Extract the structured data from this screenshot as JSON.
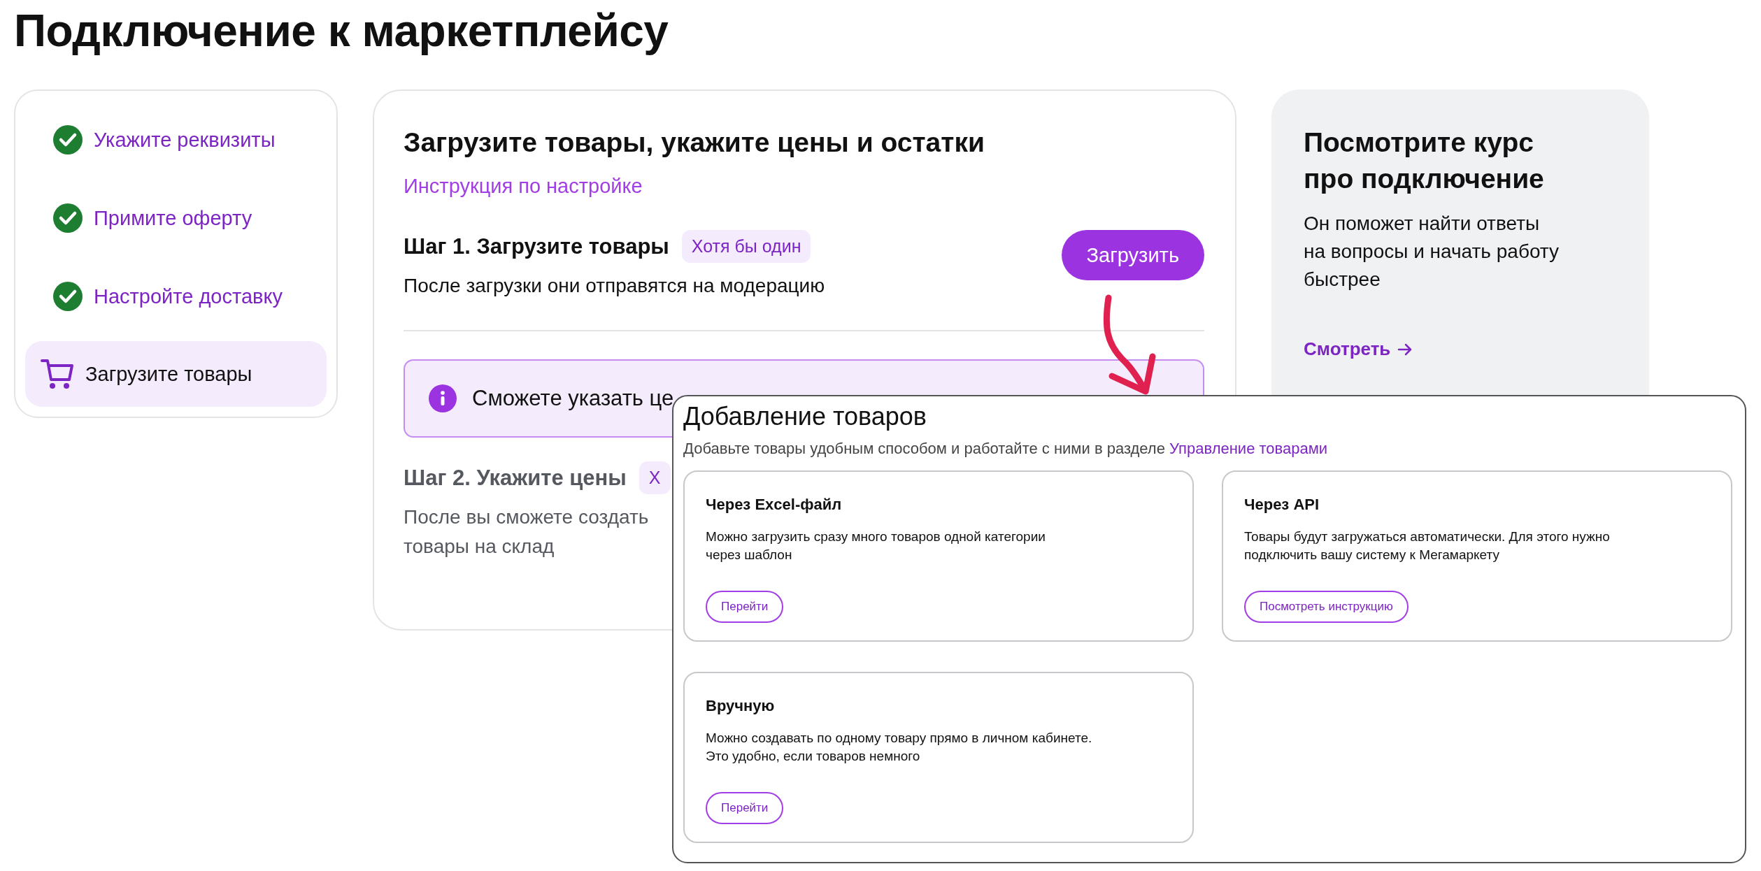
{
  "page": {
    "title": "Подключение к маркетплейсу"
  },
  "steps": [
    {
      "label": "Укажите реквизиты",
      "done": true,
      "selected": false
    },
    {
      "label": "Примите оферту",
      "done": true,
      "selected": false
    },
    {
      "label": "Настройте доставку",
      "done": true,
      "selected": false
    },
    {
      "label": "Загрузите товары",
      "done": false,
      "selected": true
    }
  ],
  "main": {
    "title": "Загрузите товары, укажите цены и остатки",
    "link": "Инструкция по настройке",
    "stages": [
      {
        "title": "Шаг 1. Загрузите товары",
        "badge": "Хотя бы один",
        "lines": [
          "После загрузки они отправятся на модерацию"
        ],
        "button": "Загрузить",
        "disabled": false
      },
      {
        "title": "Шаг 2. Укажите цены",
        "badge": "Х",
        "lines": [
          "После вы сможете создать",
          "товары на склад"
        ],
        "disabled": true
      }
    ],
    "notice": "Сможете указать це"
  },
  "course": {
    "title": "Посмотрите курс про подключение",
    "text_lines": [
      "Он поможет найти ответы",
      "на вопросы и начать работу",
      "быстрее"
    ],
    "link": "Смотреть"
  },
  "dialog": {
    "title": "Добавление товаров",
    "subtitle": "Добавьте товары удобным способом и работайте с ними в разделе",
    "subtitle_link": "Управление товарами",
    "options": [
      {
        "title": "Через Excel-файл",
        "lines": [
          "Можно загрузить сразу много товаров одной категории",
          "через шаблон"
        ],
        "button": "Перейти"
      },
      {
        "title": "Через API",
        "lines": [
          "Товары будут загружаться автоматически. Для этого нужно",
          "подключить вашу систему к Мегамаркету"
        ],
        "button": "Посмотреть инструкцию"
      },
      {
        "title": "Вручную",
        "lines": [
          "Можно создавать по одному товару прямо в личном кабинете.",
          "Это удобно, если товаров немного"
        ],
        "button": "Перейти"
      }
    ]
  }
}
